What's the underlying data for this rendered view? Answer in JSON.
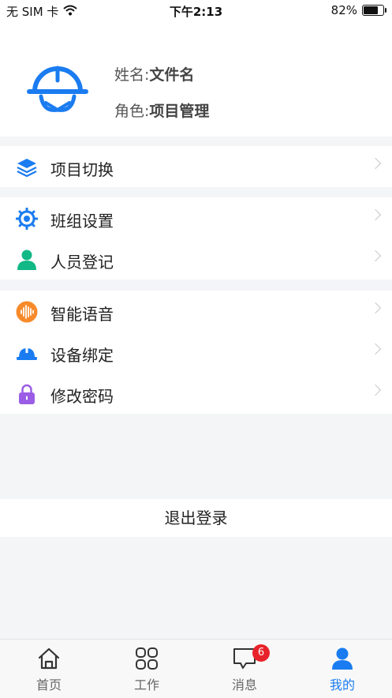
{
  "status_bar": {
    "carrier": "无 SIM 卡",
    "time": "下午2:13",
    "battery_text": "82%",
    "battery_level": 0.82,
    "wifi_icon": "wifi-icon"
  },
  "profile": {
    "avatar_icon": "hardhat-avatar-icon",
    "name_label": "姓名:",
    "name_value": "文件名",
    "role_label": "角色:",
    "role_value": "项目管理"
  },
  "menu": {
    "group1": [
      {
        "label": "项目切换",
        "icon": "layers-icon"
      }
    ],
    "group2": [
      {
        "label": "班组设置",
        "icon": "gear-icon"
      },
      {
        "label": "人员登记",
        "icon": "person-icon"
      }
    ],
    "group3": [
      {
        "label": "智能语音",
        "icon": "voice-icon"
      },
      {
        "label": "设备绑定",
        "icon": "hardhat-icon"
      },
      {
        "label": "修改密码",
        "icon": "lock-icon"
      }
    ]
  },
  "logout_label": "退出登录",
  "tabbar": {
    "tabs": [
      {
        "label": "首页",
        "icon": "home-icon"
      },
      {
        "label": "工作",
        "icon": "grid-icon"
      },
      {
        "label": "消息",
        "icon": "message-icon",
        "badge": "6"
      },
      {
        "label": "我的",
        "icon": "user-icon",
        "active": true
      }
    ]
  },
  "colors": {
    "accent": "#1a7cf0",
    "badge": "#e8222a",
    "green": "#12b886",
    "orange": "#f78a2a",
    "purple": "#9b5de5"
  }
}
